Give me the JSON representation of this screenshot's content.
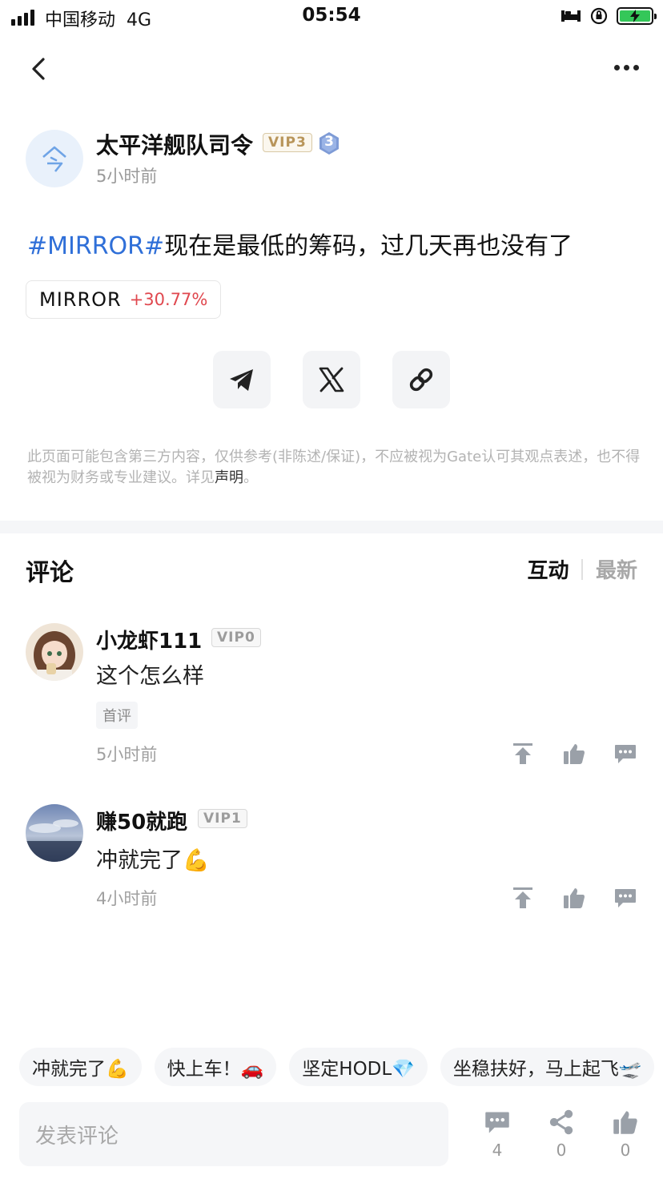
{
  "status_bar": {
    "carrier": "中国移动",
    "network": "4G",
    "time": "05:54"
  },
  "post": {
    "author": {
      "name": "太平洋舰队司令",
      "vip": "VIP3",
      "level": "3",
      "time_ago": "5小时前"
    },
    "hashtag": "#MIRROR#",
    "body": "现在是最低的筹码，过几天再也没有了",
    "coin": {
      "name": "MIRROR",
      "change": "+30.77%",
      "change_color": "#e0484f"
    },
    "disclaimer": "此页面可能包含第三方内容，仅供参考(非陈述/保证)，不应被视为Gate认可其观点表述，也不得被视为财务或专业建议。详见",
    "disclaimer_link": "声明",
    "disclaimer_end": "。"
  },
  "comments_section": {
    "title": "评论",
    "sort_active": "互动",
    "sort_inactive": "最新",
    "comments": [
      {
        "name": "小龙虾111",
        "vip": "VIP0",
        "text": "这个怎么样",
        "tag": "首评",
        "time_ago": "5小时前"
      },
      {
        "name": "赚50就跑",
        "vip": "VIP1",
        "text": "冲就完了💪",
        "time_ago": "4小时前"
      }
    ]
  },
  "quick_replies": [
    "冲就完了💪",
    "快上车！🚗",
    "坚定HODL💎",
    "坐稳扶好，马上起飞🛫"
  ],
  "bottom_bar": {
    "input_placeholder": "发表评论",
    "comment_count": "4",
    "share_count": "0",
    "like_count": "0"
  },
  "icons": {
    "accent": "#2f6fd8",
    "icon_gray": "#9aa0a8"
  }
}
